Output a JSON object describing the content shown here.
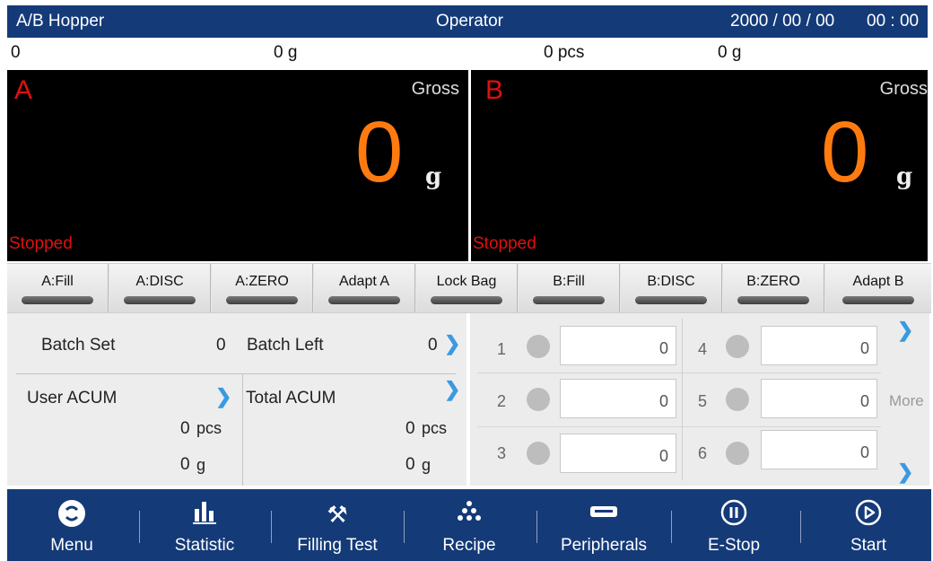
{
  "header": {
    "left_title": "A/B Hopper",
    "center_title": "Operator",
    "date": "2000 / 00 / 00",
    "time": "00 : 00"
  },
  "info": {
    "c1": "0",
    "c2": "0 g",
    "c3": "0 pcs",
    "c4": "0 g"
  },
  "panel_a": {
    "letter": "A",
    "mode": "Gross",
    "weight": "0",
    "unit": "g",
    "status": "Stopped"
  },
  "panel_b": {
    "letter": "B",
    "mode": "Gross",
    "weight": "0",
    "unit": "g",
    "status": "Stopped"
  },
  "buttons": [
    "A:Fill",
    "A:DISC",
    "A:ZERO",
    "Adapt A",
    "Lock Bag",
    "B:Fill",
    "B:DISC",
    "B:ZERO",
    "Adapt B"
  ],
  "batch": {
    "batch_set_label": "Batch Set",
    "batch_set_value": "0",
    "batch_left_label": "Batch Left",
    "batch_left_value": "0",
    "user_acum_label": "User ACUM",
    "user_pcs_value": "0",
    "user_pcs_unit": "pcs",
    "user_g_value": "0",
    "user_g_unit": "g",
    "total_acum_label": "Total ACUM",
    "total_pcs_value": "0",
    "total_pcs_unit": "pcs",
    "total_g_value": "0",
    "total_g_unit": "g"
  },
  "slots": {
    "items": [
      {
        "num": "1",
        "value": "0"
      },
      {
        "num": "2",
        "value": "0"
      },
      {
        "num": "3",
        "value": "0"
      },
      {
        "num": "4",
        "value": "0"
      },
      {
        "num": "5",
        "value": "0"
      },
      {
        "num": "6",
        "value": "0"
      }
    ],
    "more_label": "More"
  },
  "nav": [
    "Menu",
    "Statistic",
    "Filling Test",
    "Recipe",
    "Peripherals",
    "E-Stop",
    "Start"
  ],
  "colors": {
    "header_bg": "#143a78",
    "weight": "#ff7b10",
    "alert": "#e01010",
    "chevron": "#3a9ae0"
  }
}
